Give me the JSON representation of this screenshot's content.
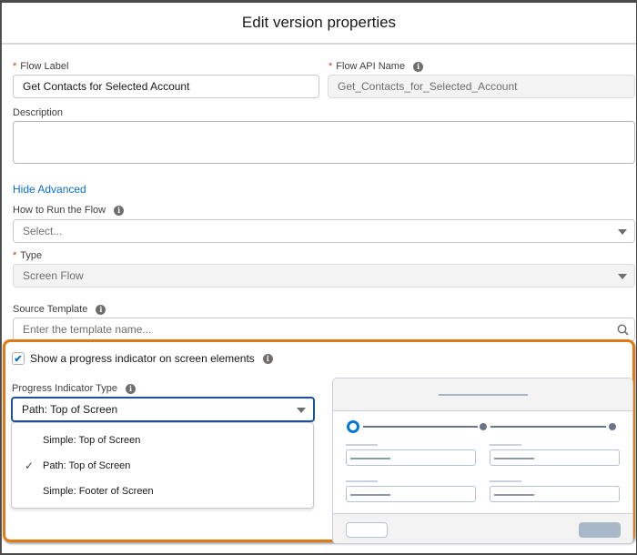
{
  "modal": {
    "title": "Edit version properties"
  },
  "form": {
    "flow_label": {
      "label": "Flow Label",
      "required": "*",
      "value": "Get Contacts for Selected Account"
    },
    "flow_api_name": {
      "label": "Flow API Name",
      "required": "*",
      "value": "Get_Contacts_for_Selected_Account"
    },
    "description": {
      "label": "Description",
      "value": ""
    },
    "hide_advanced_link": "Hide Advanced",
    "how_to_run": {
      "label": "How to Run the Flow",
      "placeholder": "Select..."
    },
    "type": {
      "label": "Type",
      "required": "*",
      "value": "Screen Flow"
    },
    "source_template": {
      "label": "Source Template",
      "placeholder": "Enter the template name..."
    },
    "show_progress": {
      "label": "Show a progress indicator on screen elements",
      "checked": true,
      "check_glyph": "✔"
    },
    "progress_type": {
      "label": "Progress Indicator Type",
      "value": "Path: Top of Screen",
      "options": [
        {
          "label": "Simple: Top of Screen",
          "selected": false
        },
        {
          "label": "Path: Top of Screen",
          "selected": true
        },
        {
          "label": "Simple: Footer of Screen",
          "selected": false
        }
      ],
      "selected_glyph": "✓"
    }
  },
  "icons": {
    "info": "i",
    "search": "search-icon"
  },
  "colors": {
    "accent": "#0176d3",
    "link": "#0b6fc7",
    "required": "#c23934",
    "highlight": "#e07a14"
  }
}
